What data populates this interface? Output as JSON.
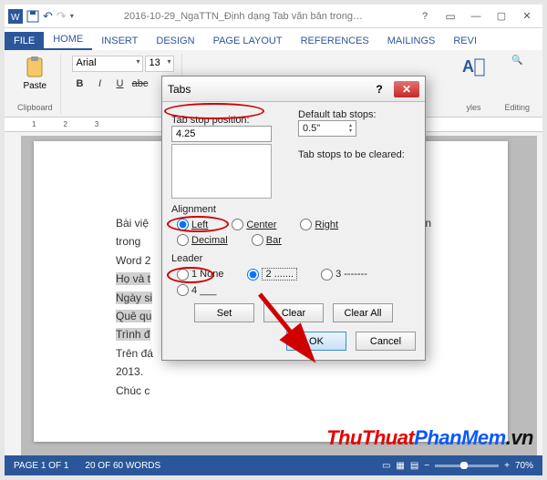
{
  "window": {
    "title": "2016-10-29_NgaTTN_Định dạng Tab văn bản trong…"
  },
  "ribbon_tabs": {
    "file": "FILE",
    "home": "HOME",
    "insert": "INSERT",
    "design": "DESIGN",
    "page_layout": "PAGE LAYOUT",
    "references": "REFERENCES",
    "mailings": "MAILINGS",
    "review": "REVI"
  },
  "ribbon": {
    "paste": "Paste",
    "clipboard_group": "Clipboard",
    "font_name": "Arial",
    "font_size": "13",
    "styles_group": "yles",
    "editing_group": "Editing"
  },
  "document": {
    "line1a": "Bài việ",
    "line1b": "n bản trong",
    "line2": "Word 2",
    "line3": "Họ và t",
    "line4": "Ngày si",
    "line5": "Quê qu",
    "line6": "Trình đ",
    "line7a": "Trên đá",
    "line7b": "ord 2013.",
    "line8": "Chúc c"
  },
  "dialog": {
    "title": "Tabs",
    "tab_stop_position_label": "Tab stop position:",
    "tab_stop_value": "4.25",
    "default_tab_stops_label": "Default tab stops:",
    "default_tab_value": "0.5\"",
    "to_be_cleared": "Tab stops to be cleared:",
    "alignment_label": "Alignment",
    "align": {
      "left": "Left",
      "center": "Center",
      "right": "Right",
      "decimal": "Decimal",
      "bar": "Bar"
    },
    "leader_label": "Leader",
    "leader": {
      "none": "1 None",
      "dots": "2 .......",
      "dashes": "3 -------",
      "under": "4 ___"
    },
    "set": "Set",
    "clear": "Clear",
    "clear_all": "Clear All",
    "ok": "OK",
    "cancel": "Cancel"
  },
  "status": {
    "page": "PAGE 1 OF 1",
    "words": "20 OF 60 WORDS",
    "zoom": "70%"
  },
  "watermark": {
    "p1": "ThuThuat",
    "p2": "PhanMem",
    "p3": ".vn"
  },
  "accent": "#2b579a"
}
